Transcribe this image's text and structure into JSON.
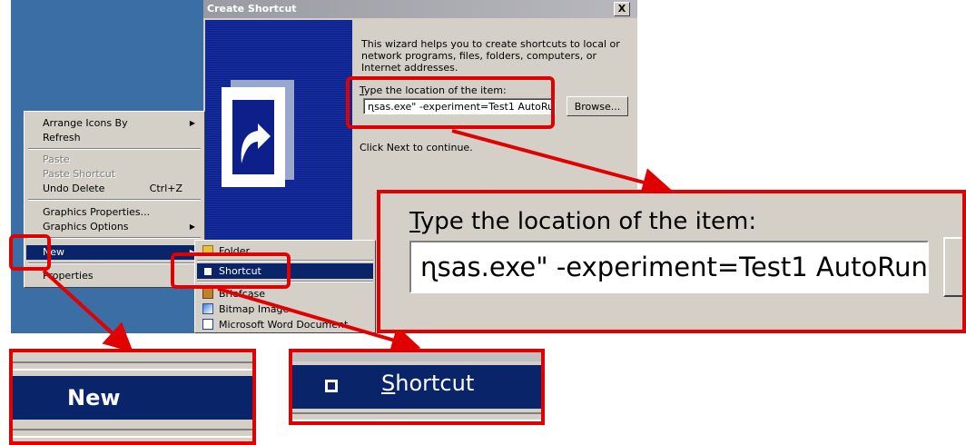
{
  "dialog": {
    "title": "Create Shortcut",
    "close_label": "X",
    "intro": "This wizard helps you to create shortcuts to local or network programs, files, folders, computers, or Internet addresses.",
    "location_label_hotkey": "T",
    "location_label_rest": "ype the location of the item:",
    "location_value": "ɳsas.exe\" -experiment=Test1 AutoRun",
    "browse_label": "Browse...",
    "next_text": "Click Next to continue."
  },
  "context_menu": {
    "items": [
      {
        "label": "Arrange Icons By",
        "submenu": true
      },
      {
        "label": "Refresh"
      },
      {
        "label": "Paste",
        "disabled": true
      },
      {
        "label": "Paste Shortcut",
        "disabled": true
      },
      {
        "label": "Undo Delete",
        "accel": "Ctrl+Z"
      },
      {
        "label": "Graphics Properties..."
      },
      {
        "label": "Graphics Options",
        "submenu": true
      },
      {
        "label": "New",
        "submenu": true,
        "highlighted": true
      },
      {
        "label": "Properties"
      }
    ]
  },
  "submenu": {
    "items": [
      {
        "label": "Folder",
        "icon": "folder-icon"
      },
      {
        "label": "Shortcut",
        "icon": "shortcut-icon",
        "highlighted": true
      },
      {
        "label": "Briefcase",
        "icon": "briefcase-icon"
      },
      {
        "label": "Bitmap Image",
        "icon": "bitmap-icon"
      },
      {
        "label": "Microsoft Word Document",
        "icon": "word-doc-icon"
      }
    ]
  },
  "zoom": {
    "location_label_hotkey": "T",
    "location_label_rest": "ype the location of the item:",
    "location_value": "ɳsas.exe\" -experiment=Test1 AutoRun",
    "new_label": "New",
    "shortcut_hotkey": "S",
    "shortcut_rest": "hortcut"
  },
  "colors": {
    "callout": "#e00000",
    "menu_highlight": "#0a246a",
    "desktop": "#3a6ea5",
    "dialog_face": "#d4d0c8"
  }
}
